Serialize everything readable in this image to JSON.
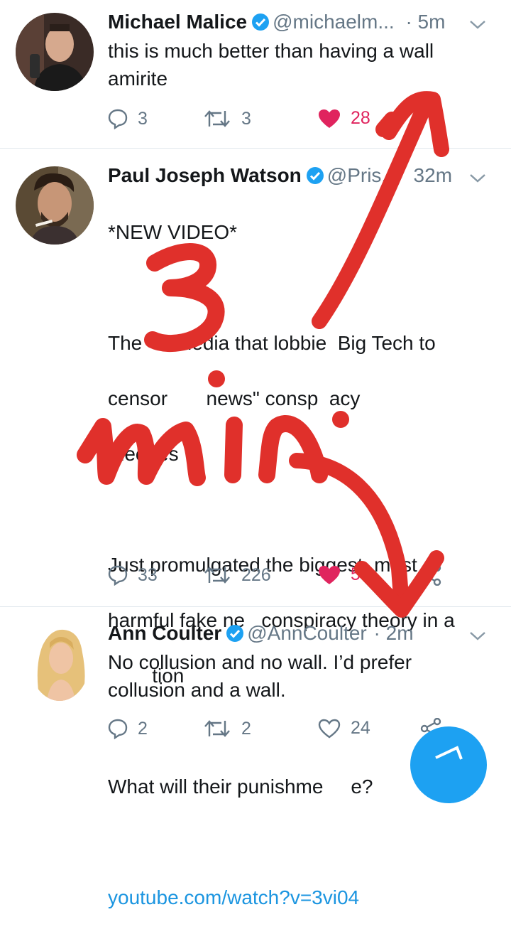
{
  "tweets": [
    {
      "name": "Michael Malice",
      "handle": "@michaelm...",
      "time": "· 5m",
      "text": "this is much better than having a wall\namirite",
      "replies": "3",
      "retweets": "3",
      "likes": "28",
      "liked": true
    },
    {
      "name": "Paul Joseph Watson",
      "handle": "@Pris...",
      "time": "32m",
      "text_lines": [
        "*NEW VIDEO*",
        "",
        "The      media that lobbie  Big Tech to",
        "censor       news\" consp  acy",
        "theories",
        "",
        "Just promulgated the biggest, most",
        "harmful fake ne   conspiracy theory in a",
        "        tion",
        "",
        "What will their punishme     e?"
      ],
      "link": "youtube.com/watch?v=3vi04",
      "replies": "33",
      "retweets": "226",
      "likes": "5",
      "liked": true
    },
    {
      "name": "Ann Coulter",
      "handle": "@AnnCoulter",
      "time": "· 2m",
      "text": "No collusion and no wall. I’d prefer\ncollusion and a wall.",
      "replies": "2",
      "retweets": "2",
      "likes": "24",
      "liked": false
    }
  ],
  "annotation": {
    "number": "3",
    "word": "min"
  },
  "colors": {
    "verified": "#1da1f2",
    "like": "#e0245e",
    "link": "#1b95e0",
    "muted": "#657786",
    "scribble": "#e0302b"
  }
}
